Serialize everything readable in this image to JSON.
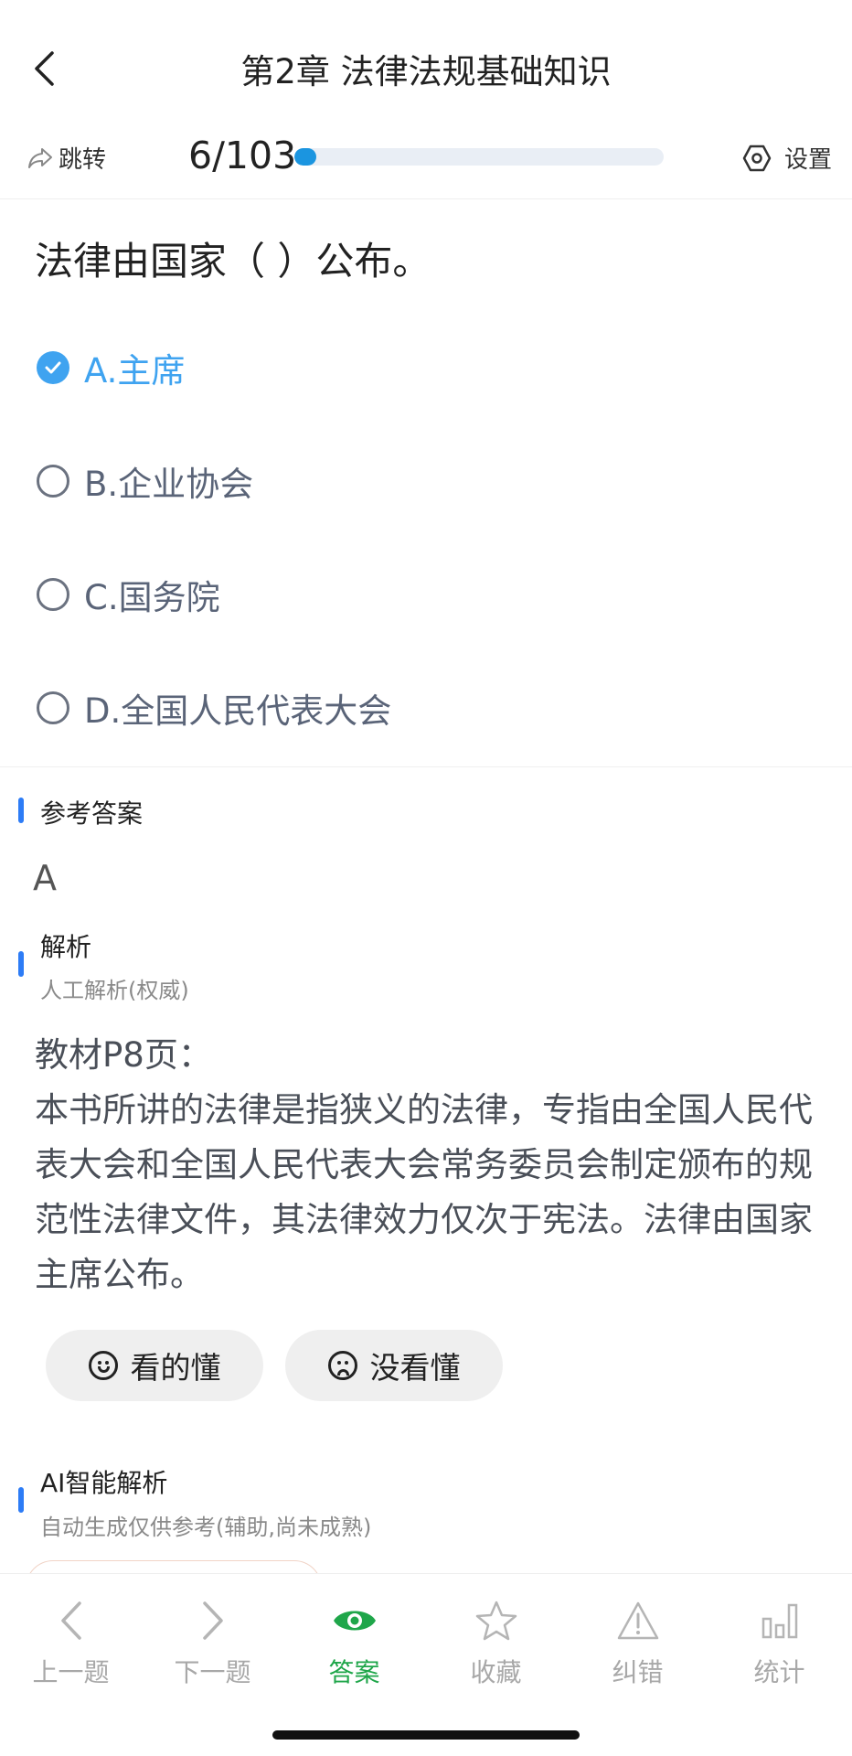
{
  "header": {
    "title": "第2章  法律法规基础知识",
    "back_icon": "chevron-left-icon"
  },
  "progress": {
    "jump_label": "跳转",
    "current": 6,
    "total": 103,
    "counter_text": "6/103",
    "settings_label": "设置"
  },
  "question": {
    "text": "法律由国家（ ）公布。",
    "options": [
      {
        "label": "A.主席",
        "selected": true
      },
      {
        "label": "B.企业协会",
        "selected": false
      },
      {
        "label": "C.国务院",
        "selected": false
      },
      {
        "label": "D.全国人民代表大会",
        "selected": false
      }
    ]
  },
  "answer": {
    "title": "参考答案",
    "value": "A"
  },
  "analysis": {
    "title": "解析",
    "subtitle": "人工解析(权威)",
    "line1": "教材P8页：",
    "body": "本书所讲的法律是指狭义的法律，专指由全国人民代表大会和全国人民代表大会常务委员会制定颁布的规范性法律文件，其法律效力仅次于宪法。法律由国家主席公布。"
  },
  "feedback": {
    "understood": "看的懂",
    "not_understood": "没看懂"
  },
  "ai": {
    "title": "AI智能解析",
    "subtitle": "自动生成仅供参考(辅助,尚未成熟)"
  },
  "nav": [
    {
      "label": "上一题",
      "icon": "chevron-left-icon",
      "active": false
    },
    {
      "label": "下一题",
      "icon": "chevron-right-icon",
      "active": false
    },
    {
      "label": "答案",
      "icon": "eye-icon",
      "active": true
    },
    {
      "label": "收藏",
      "icon": "star-icon",
      "active": false
    },
    {
      "label": "纠错",
      "icon": "warning-icon",
      "active": false
    },
    {
      "label": "统计",
      "icon": "bar-chart-icon",
      "active": false
    }
  ],
  "colors": {
    "accent_blue": "#3fa3f0",
    "progress_blue": "#1b95e0",
    "section_bar": "#2d7cf6",
    "active_green": "#1fa64a"
  }
}
